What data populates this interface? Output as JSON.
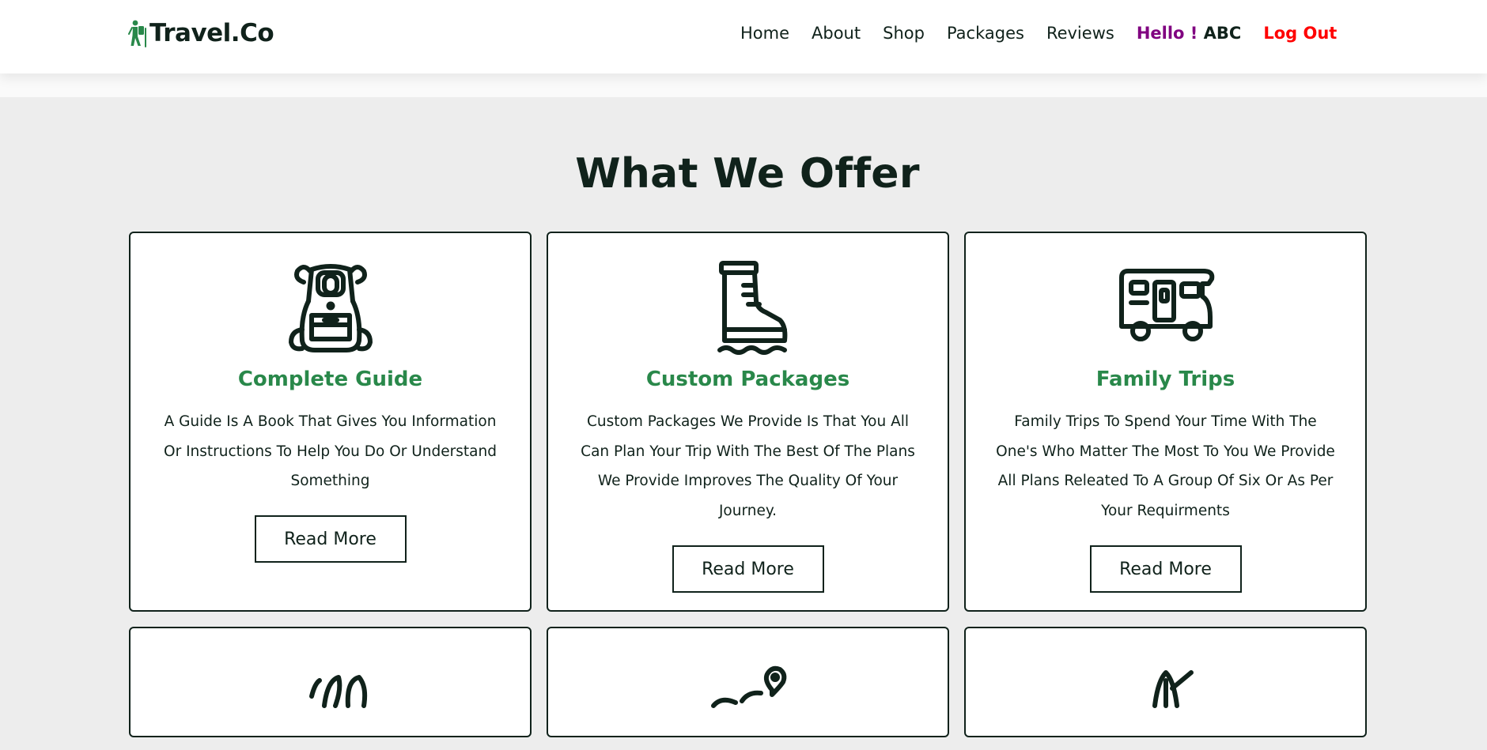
{
  "header": {
    "logo_text": "Travel.Co",
    "nav": [
      "Home",
      "About",
      "Shop",
      "Packages",
      "Reviews"
    ],
    "greeting": "Hello !",
    "username": "ABC",
    "logout": "Log Out"
  },
  "section": {
    "title": "What We Offer",
    "cards": [
      {
        "icon": "backpack-icon",
        "title": "Complete Guide",
        "text": "A Guide Is A Book That Gives You Information Or Instructions To Help You Do Or Understand Something",
        "button": "Read More"
      },
      {
        "icon": "boot-icon",
        "title": "Custom Packages",
        "text": "Custom Packages We Provide Is That You All Can Plan Your Trip With The Best Of The Plans We Provide Improves The Quality Of Your Journey.",
        "button": "Read More"
      },
      {
        "icon": "camper-van-icon",
        "title": "Family Trips",
        "text": "Family Trips To Spend Your Time With The One's Who Matter The Most To You We Provide All Plans Releated To A Group Of Six Or As Per Your Requirments",
        "button": "Read More"
      }
    ],
    "partial_cards": [
      {
        "icon": "plants-icon"
      },
      {
        "icon": "map-pin-route-icon"
      },
      {
        "icon": "kayak-paddle-icon"
      }
    ]
  },
  "colors": {
    "accent_green": "#29884a",
    "dark": "#10221b",
    "hello_purple": "#800080",
    "logout_red": "#ff0000",
    "background": "#ededed"
  }
}
